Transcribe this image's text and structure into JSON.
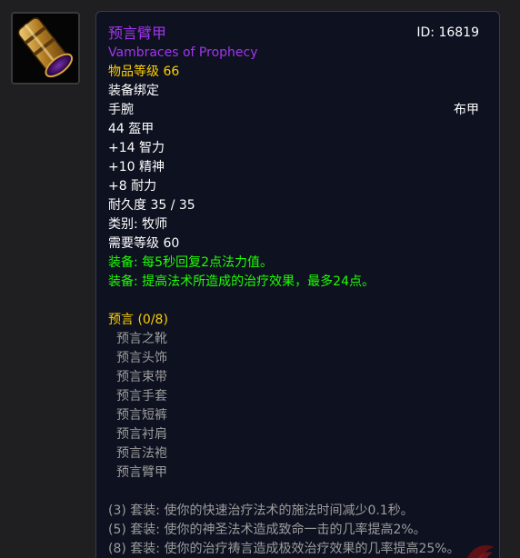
{
  "item": {
    "name_cn": "预言臂甲",
    "name_en": "Vambraces of Prophecy",
    "id_label": "ID: 16819",
    "item_level": "物品等级 66",
    "binding": "装备绑定",
    "slot": "手腕",
    "armor_type": "布甲",
    "armor": "44 盔甲",
    "stats": [
      "+14 智力",
      "+10 精神",
      "+8 耐力"
    ],
    "durability": "耐久度 35 / 35",
    "class_req": "类别: 牧师",
    "level_req": "需要等级 60",
    "equip_effects": [
      "装备: 每5秒回复2点法力值。",
      "装备: 提高法术所造成的治疗效果，最多24点。"
    ],
    "set_name": "预言 (0/8)",
    "set_pieces": [
      "预言之靴",
      "预言头饰",
      "预言束带",
      "预言手套",
      "预言短裤",
      "预言衬肩",
      "预言法袍",
      "预言臂甲"
    ],
    "set_bonuses": [
      "(3) 套装: 使你的快速治疗法术的施法时间减少0.1秒。",
      "(5) 套装: 使你的神圣法术造成致命一击的几率提高2%。",
      "(8) 套装: 使你的治疗祷言造成极效治疗效果的几率提高25%。"
    ]
  },
  "colors": {
    "epic_purple": "#a335ee",
    "gold": "#ffd100",
    "equip_green": "#1eff00",
    "inactive_gray": "#9d9d9d",
    "panel_bg": "#0d1120"
  },
  "icons": {
    "item_icon": "vambraces-icon",
    "corner_logo": "site-logo-icon"
  }
}
